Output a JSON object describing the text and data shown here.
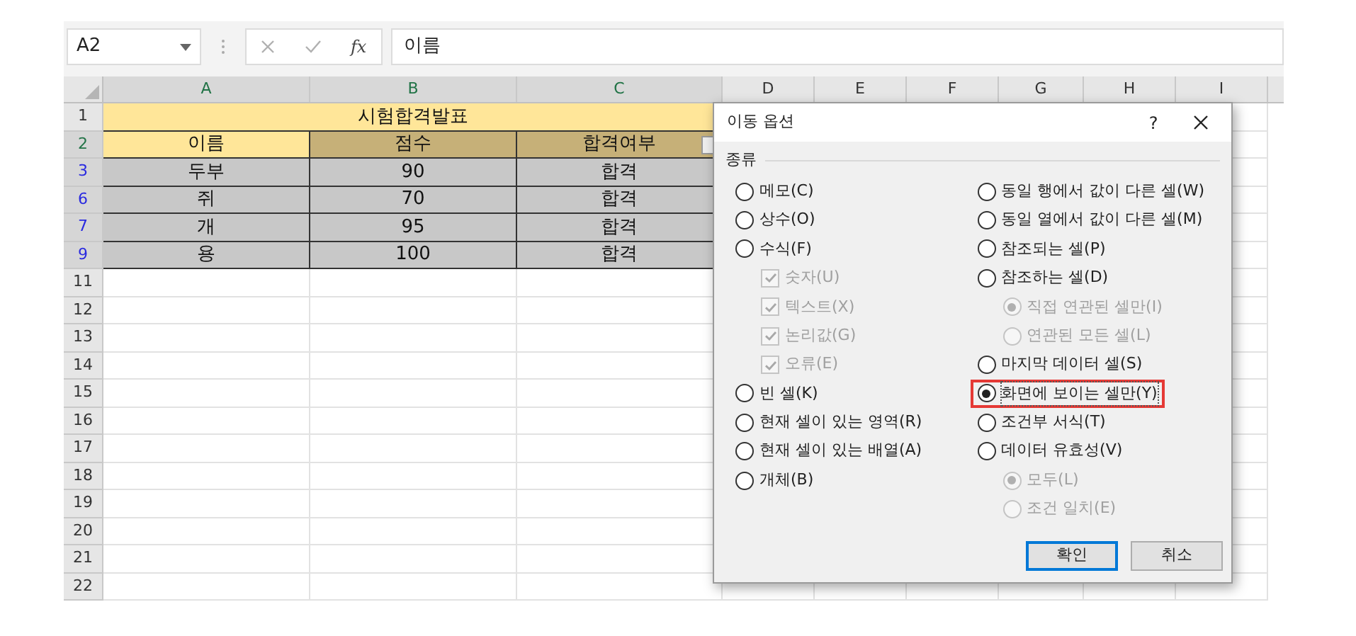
{
  "formula_bar": {
    "name_box": "A2",
    "function_label": "fx",
    "formula": "이름"
  },
  "columns": [
    {
      "label": "A",
      "selected": true
    },
    {
      "label": "B",
      "selected": true
    },
    {
      "label": "C",
      "selected": true
    },
    {
      "label": "D",
      "selected": false
    },
    {
      "label": "E",
      "selected": false
    },
    {
      "label": "F",
      "selected": false
    },
    {
      "label": "G",
      "selected": false
    },
    {
      "label": "H",
      "selected": false
    },
    {
      "label": "I",
      "selected": false
    }
  ],
  "rows": [
    {
      "number": "1",
      "kind": "title",
      "selected": false,
      "filtered": false,
      "cells": [
        "시험합격발표"
      ]
    },
    {
      "number": "2",
      "kind": "header",
      "selected": true,
      "filtered": false,
      "cells": [
        {
          "text": "이름",
          "active": true
        },
        {
          "text": "점수",
          "active": false
        },
        {
          "text": "합격여부",
          "active": false,
          "filter_button": true
        }
      ]
    },
    {
      "number": "3",
      "kind": "data",
      "selected": true,
      "filtered": true,
      "cells": [
        "두부",
        "90",
        "합격"
      ]
    },
    {
      "number": "6",
      "kind": "data",
      "selected": true,
      "filtered": true,
      "cells": [
        "쥐",
        "70",
        "합격"
      ]
    },
    {
      "number": "7",
      "kind": "data",
      "selected": true,
      "filtered": true,
      "cells": [
        "개",
        "95",
        "합격"
      ]
    },
    {
      "number": "9",
      "kind": "data",
      "selected": true,
      "filtered": true,
      "cells": [
        "용",
        "100",
        "합격"
      ]
    },
    {
      "number": "11",
      "kind": "empty",
      "selected": false,
      "filtered": false
    },
    {
      "number": "12",
      "kind": "empty",
      "selected": false,
      "filtered": false
    },
    {
      "number": "13",
      "kind": "empty",
      "selected": false,
      "filtered": false
    },
    {
      "number": "14",
      "kind": "empty",
      "selected": false,
      "filtered": false
    },
    {
      "number": "15",
      "kind": "empty",
      "selected": false,
      "filtered": false
    },
    {
      "number": "16",
      "kind": "empty",
      "selected": false,
      "filtered": false
    },
    {
      "number": "17",
      "kind": "empty",
      "selected": false,
      "filtered": false
    },
    {
      "number": "18",
      "kind": "empty",
      "selected": false,
      "filtered": false
    },
    {
      "number": "19",
      "kind": "empty",
      "selected": false,
      "filtered": false
    },
    {
      "number": "20",
      "kind": "empty",
      "selected": false,
      "filtered": false
    },
    {
      "number": "21",
      "kind": "empty",
      "selected": false,
      "filtered": false
    },
    {
      "number": "22",
      "kind": "empty",
      "selected": false,
      "filtered": false
    }
  ],
  "dialog": {
    "title": "이동 옵션",
    "help": "?",
    "section": "종류",
    "left_options": [
      {
        "kind": "radio",
        "label": "메모(C)",
        "selected": false,
        "disabled": false,
        "highlighted": false
      },
      {
        "kind": "radio",
        "label": "상수(O)",
        "selected": false,
        "disabled": false,
        "highlighted": false
      },
      {
        "kind": "radio",
        "label": "수식(F)",
        "selected": false,
        "disabled": false,
        "highlighted": false,
        "children": [
          {
            "kind": "checkbox",
            "label": "숫자(U)",
            "checked": true,
            "disabled": true,
            "highlighted": false
          },
          {
            "kind": "checkbox",
            "label": "텍스트(X)",
            "checked": true,
            "disabled": true,
            "highlighted": false
          },
          {
            "kind": "checkbox",
            "label": "논리값(G)",
            "checked": true,
            "disabled": true,
            "highlighted": false
          },
          {
            "kind": "checkbox",
            "label": "오류(E)",
            "checked": true,
            "disabled": true,
            "highlighted": false
          }
        ]
      },
      {
        "kind": "radio",
        "label": "빈 셀(K)",
        "selected": false,
        "disabled": false,
        "highlighted": false
      },
      {
        "kind": "radio",
        "label": "현재 셀이 있는 영역(R)",
        "selected": false,
        "disabled": false,
        "highlighted": false
      },
      {
        "kind": "radio",
        "label": "현재 셀이 있는 배열(A)",
        "selected": false,
        "disabled": false,
        "highlighted": false
      },
      {
        "kind": "radio",
        "label": "개체(B)",
        "selected": false,
        "disabled": false,
        "highlighted": false
      }
    ],
    "right_options": [
      {
        "kind": "radio",
        "label": "동일 행에서 값이 다른 셀(W)",
        "selected": false,
        "disabled": false,
        "highlighted": false
      },
      {
        "kind": "radio",
        "label": "동일 열에서 값이 다른 셀(M)",
        "selected": false,
        "disabled": false,
        "highlighted": false
      },
      {
        "kind": "radio",
        "label": "참조되는 셀(P)",
        "selected": false,
        "disabled": false,
        "highlighted": false
      },
      {
        "kind": "radio",
        "label": "참조하는 셀(D)",
        "selected": false,
        "disabled": false,
        "highlighted": false,
        "children": [
          {
            "kind": "radio",
            "label": "직접 연관된 셀만(I)",
            "selected": true,
            "disabled": true,
            "highlighted": false
          },
          {
            "kind": "radio",
            "label": "연관된 모든 셀(L)",
            "selected": false,
            "disabled": true,
            "highlighted": false
          }
        ]
      },
      {
        "kind": "radio",
        "label": "마지막 데이터 셀(S)",
        "selected": false,
        "disabled": false,
        "highlighted": false
      },
      {
        "kind": "radio",
        "label": "화면에 보이는 셀만(Y)",
        "selected": true,
        "disabled": false,
        "highlighted": true
      },
      {
        "kind": "radio",
        "label": "조건부 서식(T)",
        "selected": false,
        "disabled": false,
        "highlighted": false
      },
      {
        "kind": "radio",
        "label": "데이터 유효성(V)",
        "selected": false,
        "disabled": false,
        "highlighted": false,
        "children": [
          {
            "kind": "radio",
            "label": "모두(L)",
            "selected": true,
            "disabled": true,
            "highlighted": false
          },
          {
            "kind": "radio",
            "label": "조건 일치(E)",
            "selected": false,
            "disabled": true,
            "highlighted": false
          }
        ]
      }
    ],
    "buttons": [
      {
        "label": "확인",
        "default": true
      },
      {
        "label": "취소",
        "default": false
      }
    ]
  }
}
